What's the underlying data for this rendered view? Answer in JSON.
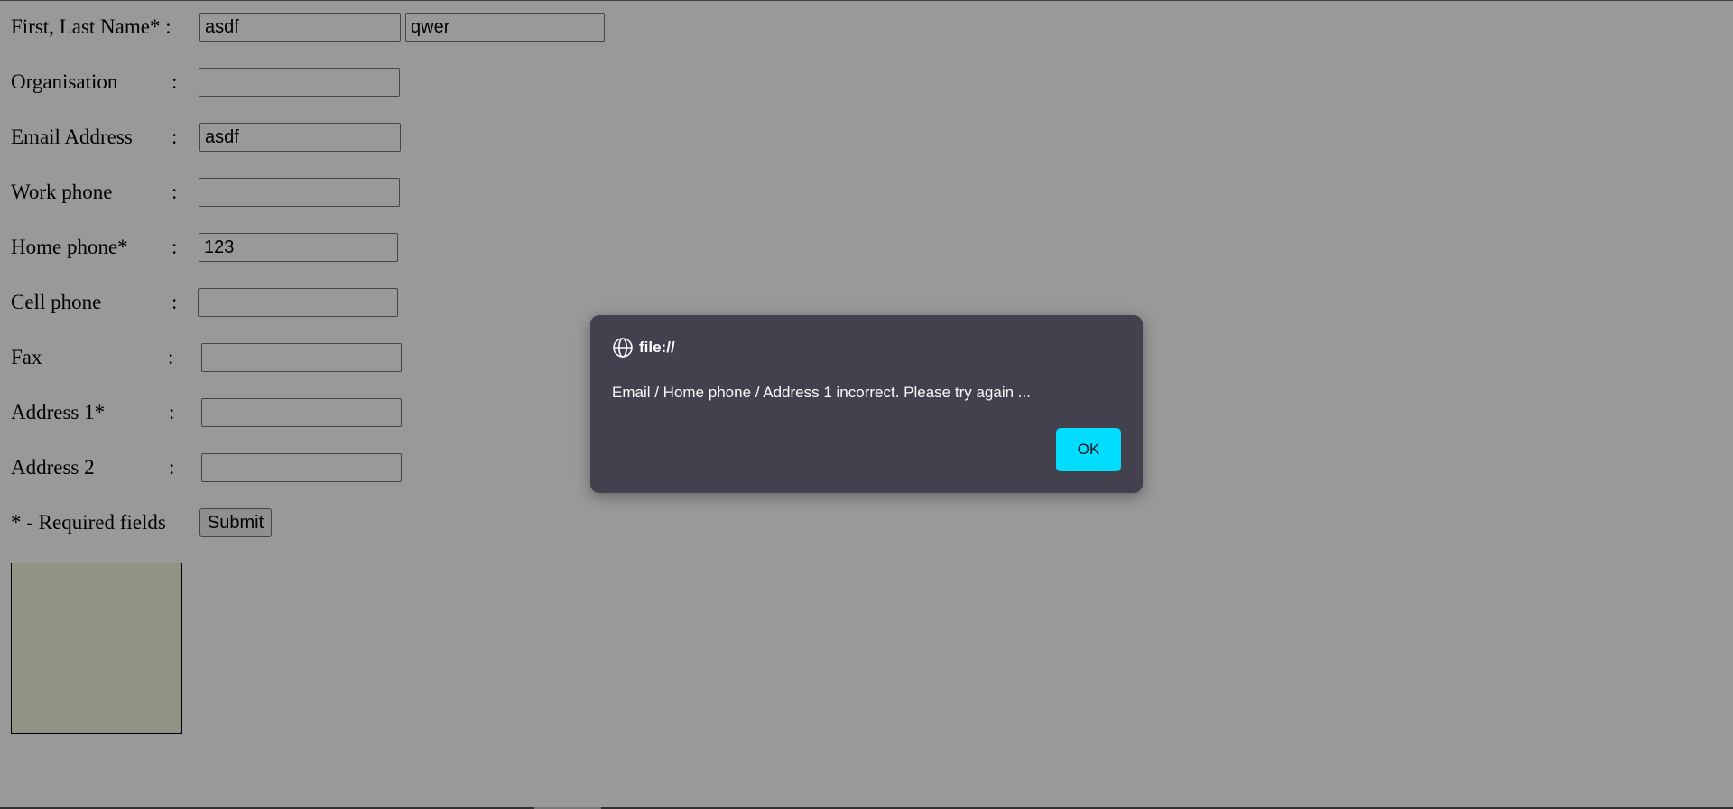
{
  "form": {
    "name": {
      "label": "First, Last Name* :",
      "first_value": "asdf",
      "last_value": "qwer"
    },
    "organisation": {
      "label": "Organisation",
      "colon": ":",
      "value": ""
    },
    "email": {
      "label": "Email Address",
      "colon": ":",
      "value": "asdf"
    },
    "work_phone": {
      "label": "Work phone",
      "colon": ":",
      "value": ""
    },
    "home_phone": {
      "label": "Home phone*",
      "colon": ":",
      "value": "123"
    },
    "cell_phone": {
      "label": "Cell phone",
      "colon": ":",
      "value": ""
    },
    "fax": {
      "label": "Fax",
      "colon": ":",
      "value": ""
    },
    "address1": {
      "label": "Address 1*",
      "colon": ":",
      "value": ""
    },
    "address2": {
      "label": "Address 2",
      "colon": ":",
      "value": ""
    },
    "required_note": "* - Required fields",
    "submit_label": "Submit"
  },
  "dialog": {
    "origin": "file://",
    "message": "Email / Home phone / Address 1 incorrect. Please try again ...",
    "ok_label": "OK",
    "icon": "globe-icon"
  },
  "colors": {
    "dialog_bg": "#42414d",
    "ok_button": "#00ddff",
    "canvas_fill": "#f5f5dc"
  }
}
